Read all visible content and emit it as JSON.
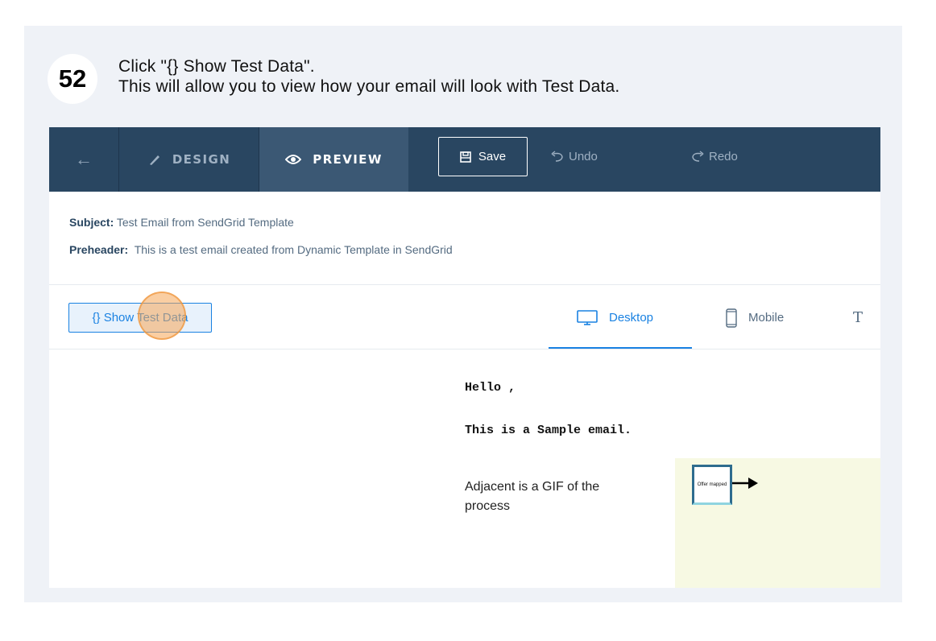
{
  "step": {
    "number": "52",
    "line1": "Click \"{} Show Test Data\".",
    "line2": "This will allow you to view how your email will look with Test Data."
  },
  "toolbar": {
    "back_icon": "arrow-left-icon",
    "design_label": "DESIGN",
    "preview_label": "PREVIEW",
    "save_label": "Save",
    "undo_label": "Undo",
    "redo_label": "Redo"
  },
  "meta": {
    "subject_label": "Subject:",
    "subject_value": "Test Email from SendGrid Template",
    "preheader_label": "Preheader:",
    "preheader_value": "This is a test email created from Dynamic Template in SendGrid"
  },
  "preview_controls": {
    "show_test_data_label": "{} Show Test Data",
    "desktop_label": "Desktop",
    "mobile_label": "Mobile",
    "text_label": "T"
  },
  "email": {
    "hello": "Hello ,",
    "sample": "This is a Sample email.",
    "adjacent": "Adjacent is a GIF of the process",
    "gif_box_text": "Offer mapped"
  },
  "colors": {
    "topbar": "#294661",
    "accent": "#1a82e2",
    "highlight": "#f5a655"
  }
}
